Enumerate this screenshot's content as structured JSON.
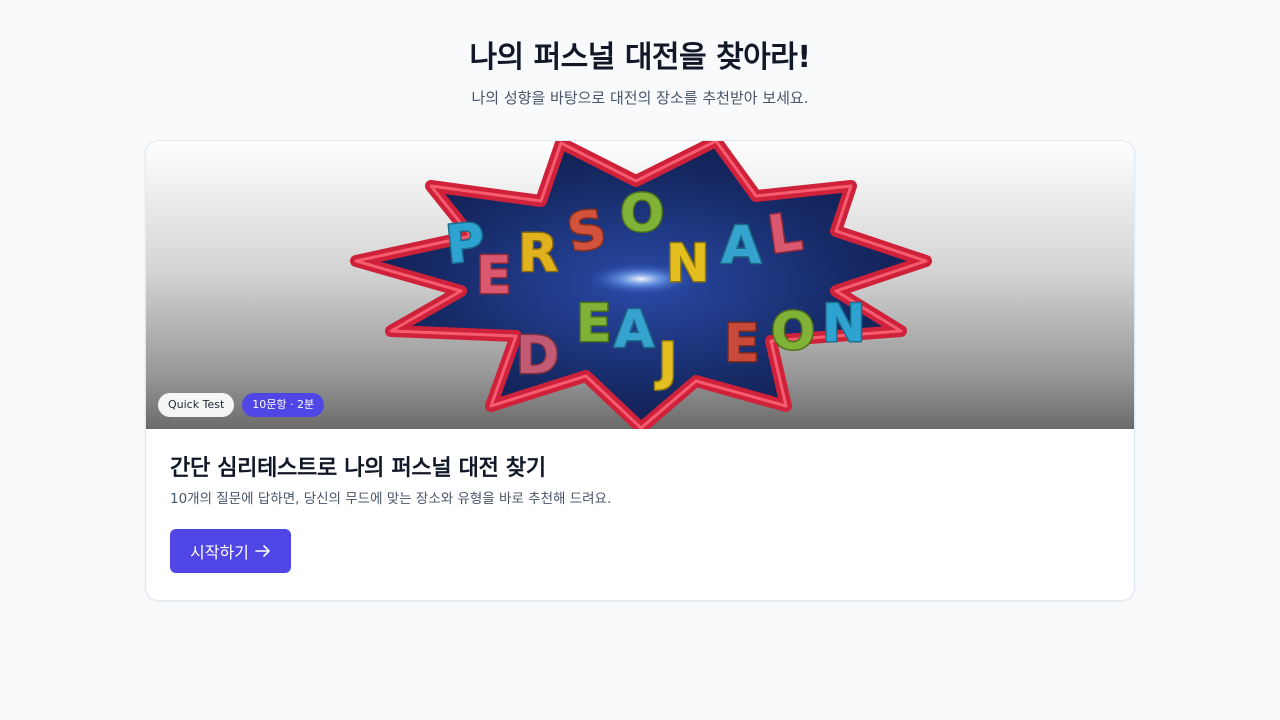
{
  "header": {
    "title": "나의 퍼스널 대전을 찾아라!",
    "subtitle": "나의 성향을 바탕으로 대전의 장소를 추천받아 보세요."
  },
  "card": {
    "hero": {
      "line1": "PERSONAL",
      "line2": "DAEJEON",
      "badges": {
        "quick": "Quick Test",
        "meta": "10문항 · 2분"
      }
    },
    "title": "간단 심리테스트로 나의 퍼스널 대전 찾기",
    "description": "10개의 질문에 답하면, 당신의 무드에 맞는 장소와 유형을 바로 추천해 드려요.",
    "start_button": "시작하기",
    "start_icon": "arrow-right-icon"
  },
  "colors": {
    "accent": "#4f46e5",
    "burst_outline": "#d0213a",
    "burst_fill": "#14245a"
  }
}
